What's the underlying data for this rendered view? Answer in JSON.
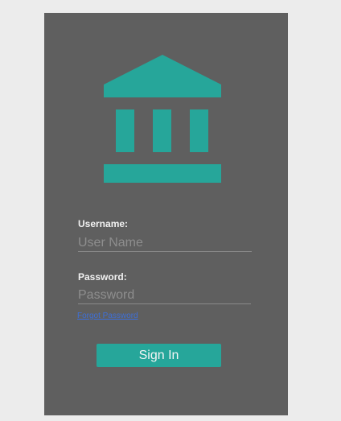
{
  "login": {
    "logo_icon": "bank-building-icon",
    "accent_color": "#26a69a",
    "panel_color": "#5f5f5f",
    "username": {
      "label": "Username:",
      "placeholder": "User Name",
      "value": ""
    },
    "password": {
      "label": "Password:",
      "placeholder": "Password",
      "value": ""
    },
    "forgot_password": "Forgot Password",
    "sign_in": "Sign In"
  }
}
